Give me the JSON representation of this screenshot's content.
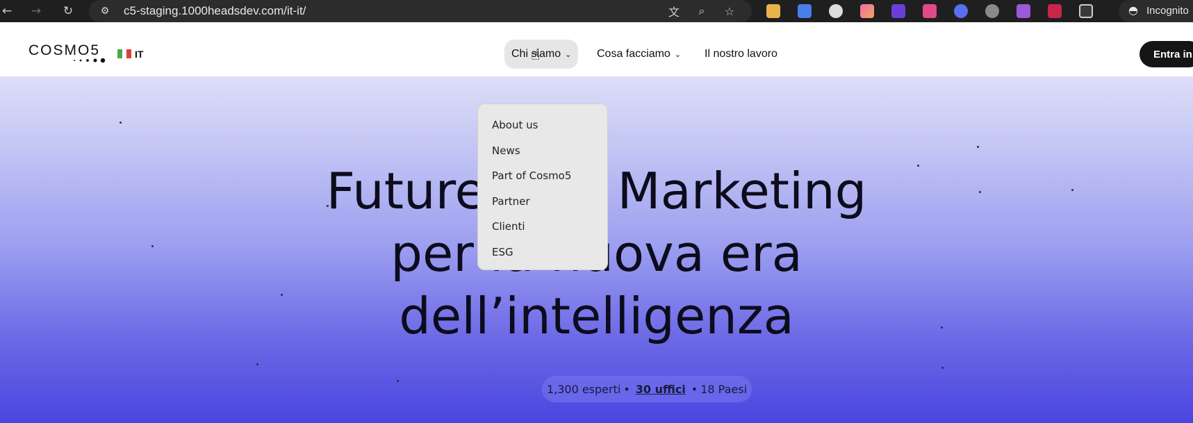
{
  "browser": {
    "url": "c5-staging.1000headsdev.com/it-it/",
    "incognito_label": "Incognito"
  },
  "header": {
    "logo": "COSMO5",
    "lang": "IT",
    "nav": [
      {
        "label": "Chi siamo"
      },
      {
        "label": "Cosa facciamo"
      },
      {
        "label": "Il nostro lavoro"
      }
    ],
    "cta": "Entra in"
  },
  "dropdown": {
    "items": [
      "About us",
      "News",
      "Part of Cosmo5",
      "Partner",
      "Clienti",
      "ESG"
    ]
  },
  "hero": {
    "lines": [
      "Future-first Marketing",
      "per la nuova era",
      "dell’intelligenza"
    ]
  },
  "stats": {
    "experts": "1,300 esperti",
    "offices": "30 uffici",
    "countries": "18 Paesi",
    "separator": "•"
  },
  "colors": {
    "flag_green": "#4aa84a",
    "flag_white": "#ffffff",
    "flag_red": "#d9403a"
  }
}
